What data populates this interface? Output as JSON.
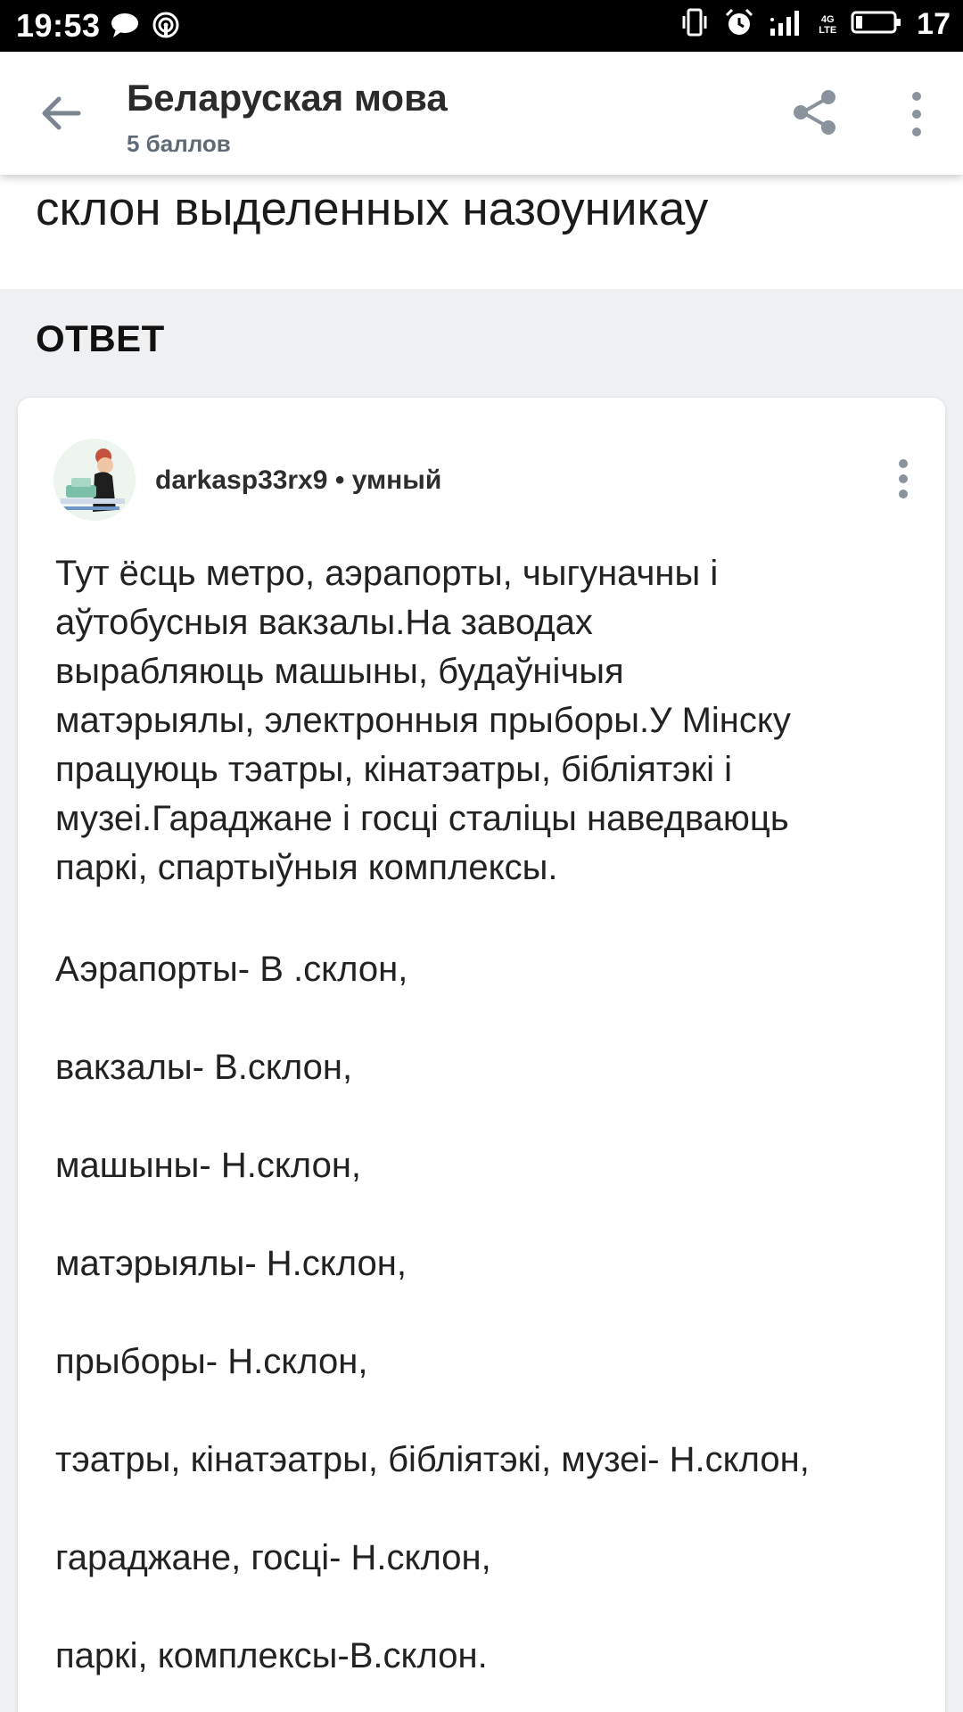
{
  "status_bar": {
    "time": "19:53",
    "network": "4G",
    "network_sub": "LTE",
    "battery": "17"
  },
  "app_bar": {
    "title": "Беларуская мова",
    "subtitle": "5 баллов"
  },
  "question": {
    "text_tail": "склон выделенных назоуникау"
  },
  "answer_section": {
    "heading": "ОТВЕТ",
    "author": "darkasp33rx9",
    "separator": "•",
    "author_rank": "умный",
    "paragraph_lines": [
      "Тут ёсць метро, аэрапорты, чыгуначны і",
      "аўтобусныя вакзалы.На заводах",
      "вырабляюць машыны, будаўнічыя",
      "матэрыялы, электронныя прыборы.У Мінску",
      "працуюць тэатры, кінатэатры, бібліятэкі і",
      "музеі.Гараджане і госці сталіцы наведваюць",
      "паркі, спартыўныя комплексы."
    ],
    "cases": [
      "Аэрапорты- В .склон,",
      "вакзалы- В.склон,",
      "машыны- Н.склон,",
      "матэрыялы- Н.склон,",
      "прыборы- Н.склон,",
      "тэатры, кінатэатры, бібліятэкі, музеі- Н.склон,",
      "гараджане, госці- Н.склон,",
      "паркі, комплексы-В.склон."
    ]
  }
}
